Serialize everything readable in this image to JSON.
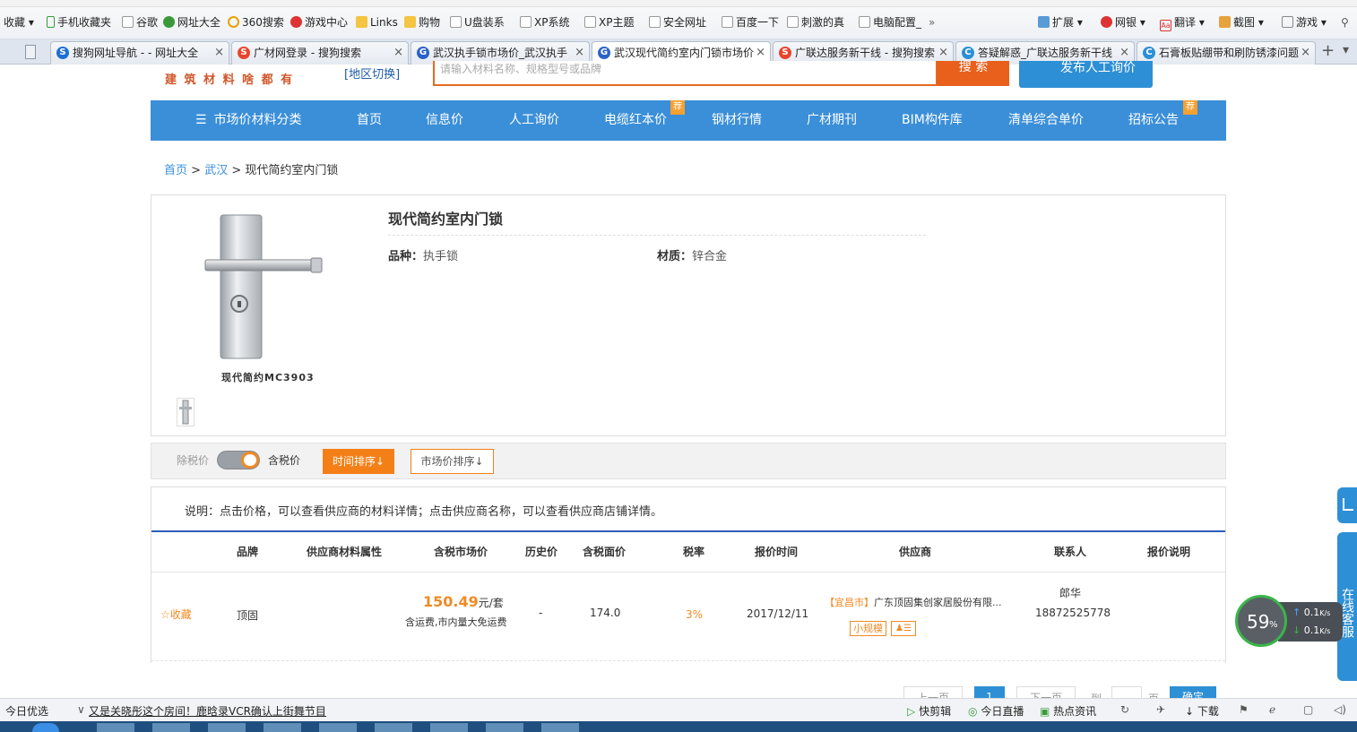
{
  "bookmarks": {
    "items": [
      "收藏",
      "手机收藏夹",
      "谷歌",
      "网址大全",
      "360搜索",
      "游戏中心",
      "Links",
      "购物",
      "U盘装系",
      "XP系统",
      "XP主题",
      "安全网址",
      "百度一下",
      "刺激的真",
      "电脑配置_"
    ],
    "more": "»",
    "right": [
      "扩展",
      "网银",
      "翻译",
      "截图",
      "游戏"
    ]
  },
  "tabs": [
    {
      "label": "搜狗网址导航 - - 网址大全",
      "icon": "S"
    },
    {
      "label": "广材网登录 - 搜狗搜索",
      "icon": "S"
    },
    {
      "label": "武汉执手锁市场价_武汉执手",
      "icon": "G"
    },
    {
      "label": "武汉现代简约室内门锁市场价",
      "icon": "G"
    },
    {
      "label": "广联达服务新干线 - 搜狗搜索",
      "icon": "S"
    },
    {
      "label": "答疑解惑_广联达服务新干线",
      "icon": "C"
    },
    {
      "label": "石膏板贴绷带和刷防锈漆问题",
      "icon": "C"
    }
  ],
  "header": {
    "logo_text": "建 筑 材 料 啥 都 有",
    "region_switch": "[地区切换]",
    "search_placeholder": "请输入材料名称、规格型号或品牌",
    "search_button": "搜 索",
    "publish_button": "发布人工询价"
  },
  "nav": {
    "category": "市场价材料分类",
    "items": [
      "首页",
      "信息价",
      "人工询价",
      "电缆红本价",
      "钢材行情",
      "广材期刊",
      "BIM构件库",
      "清单综合单价",
      "招标公告"
    ],
    "badge": "荐"
  },
  "breadcrumb": {
    "home": "首页",
    "city": "武汉",
    "current": "现代简约室内门锁",
    "sep": ">"
  },
  "product": {
    "title": "现代简约室内门锁",
    "image_caption": "现代简约MC3903",
    "variety_label": "品种：",
    "variety_value": "执手锁",
    "material_label": "材质：",
    "material_value": "锌合金"
  },
  "sortbar": {
    "exclude_tax": "除税价",
    "include_tax": "含税价",
    "time_sort": "时间排序↓",
    "price_sort": "市场价排序↓"
  },
  "notice": "说明：点击价格，可以查看供应商的材料详情；点击供应商名称，可以查看供应商店铺详情。",
  "table": {
    "headers": [
      "品牌",
      "供应商材料属性",
      "含税市场价",
      "历史价",
      "含税面价",
      "税率",
      "报价时间",
      "供应商",
      "联系人",
      "报价说明"
    ],
    "rows": [
      {
        "favorite": "☆收藏",
        "brand": "顶固",
        "attr": "",
        "price": "150.49",
        "unit": "元/套",
        "price_note": "含运费,市内量大免运费",
        "history": "-",
        "face_price": "174.0",
        "tax": "3%",
        "date": "2017/12/11",
        "supplier_city": "【宜昌市】",
        "supplier": "广东顶固集创家居股份有限...",
        "supplier_tag": "小规模",
        "contact_name": "郎华",
        "contact_phone": "18872525778"
      }
    ]
  },
  "pagination": {
    "prev": "上一页",
    "current": "1",
    "next": "下一页",
    "goto": "到",
    "page": "页",
    "confirm": "确定"
  },
  "float_widget": {
    "percent": "59",
    "percent_sign": "%",
    "up": "0.1",
    "down": "0.1",
    "unit": "K/s",
    "side_text": "在线客服"
  },
  "statusbar": {
    "left": "今日优选",
    "news": "又是关晓彤这个房间！鹿晗录VCR确认上街舞节目",
    "right": [
      "快剪辑",
      "今日直播",
      "热点资讯",
      "下载"
    ]
  }
}
